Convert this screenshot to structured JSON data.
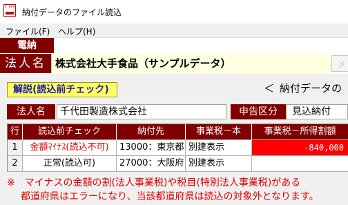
{
  "window": {
    "icon_text": "ﾋﾟｶﾁｬ",
    "title": "納付データのファイル読込"
  },
  "menu": {
    "file": "ファイル(F)",
    "help": "ヘルプ(H)"
  },
  "tab": {
    "active_label": "電納"
  },
  "corporation": {
    "label": "法人名",
    "value": "株式会社大手食品（サンプルデータ）",
    "button_label": "メ"
  },
  "explain_button": "解説(読込前チェック)",
  "arrow_text": {
    "glyph": "＜",
    "text": "納付データの"
  },
  "info": {
    "corp_label": "法人名",
    "corp_value": "千代田製造株式会社",
    "type_label": "申告区分",
    "type_value": "見込納付"
  },
  "table": {
    "headers": [
      "行",
      "読込前チェック",
      "納付先",
      "事業税－本",
      "事業税－所得割額"
    ],
    "rows": [
      {
        "no": "1",
        "check": "金額ﾏｲﾅｽ(読込不可)",
        "dest": "13000：東京都",
        "main": "別建表示",
        "income": "-840,000",
        "error": true
      },
      {
        "no": "2",
        "check": "正常(読込可)",
        "dest": "27000：大阪府",
        "main": "別建表示",
        "income": "",
        "error": false
      }
    ]
  },
  "note": {
    "line1": "※　マイナスの金額の割(法人事業税)や税目(特別法人事業税)がある",
    "line2": "都道府県はエラーになり、当該都道府県は読込の対象外となります。"
  },
  "colors": {
    "maroon": "#800000",
    "error_red": "#ff0000",
    "note_red": "#e00000",
    "explain_yellow": "#ffff66",
    "corp_field": "#ffffe0"
  }
}
